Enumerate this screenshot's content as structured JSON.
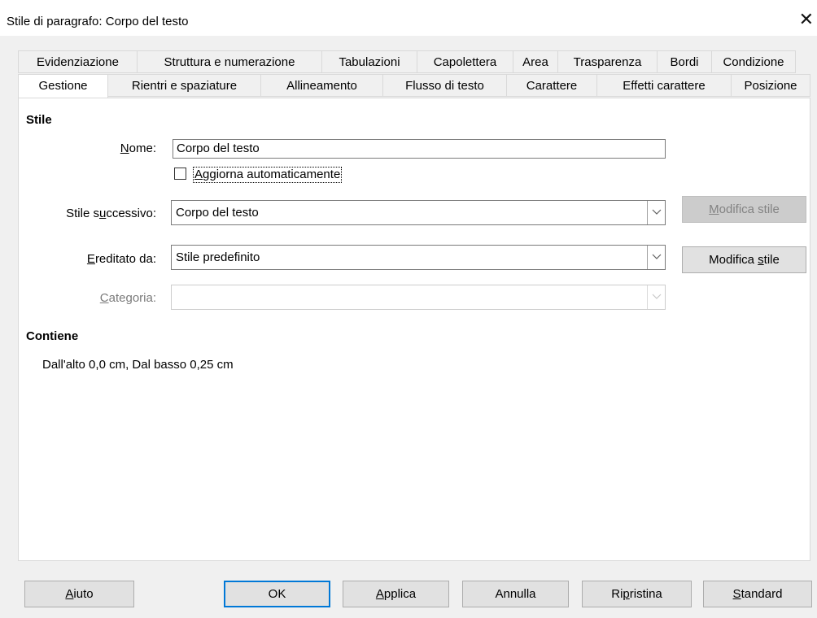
{
  "window": {
    "title": "Stile di paragrafo: Corpo del testo",
    "close_icon": "close-icon"
  },
  "tabs_row1": [
    {
      "label": "Evidenziazione"
    },
    {
      "label": "Struttura e numerazione"
    },
    {
      "label": "Tabulazioni"
    },
    {
      "label": "Capolettera"
    },
    {
      "label": "Area"
    },
    {
      "label": "Trasparenza"
    },
    {
      "label": "Bordi"
    },
    {
      "label": "Condizione"
    }
  ],
  "tabs_row2": [
    {
      "label": "Gestione",
      "active": true
    },
    {
      "label": "Rientri e spaziature"
    },
    {
      "label": "Allineamento"
    },
    {
      "label": "Flusso di testo"
    },
    {
      "label": "Carattere"
    },
    {
      "label": "Effetti carattere"
    },
    {
      "label": "Posizione"
    }
  ],
  "style_section": {
    "title": "Stile",
    "name_label_pre": "",
    "name_label_u": "N",
    "name_label_post": "ome:",
    "name_value": "Corpo del testo",
    "auto_update_u": "A",
    "auto_update_rest": "ggiorna automaticamente",
    "next_style_label_pre": "Stile s",
    "next_style_label_u": "u",
    "next_style_label_post": "ccessivo:",
    "next_style_value": "Corpo del testo",
    "edit_style_disabled_u": "M",
    "edit_style_disabled_rest": "odifica stile",
    "inherited_label_u": "E",
    "inherited_label_rest": "reditato da:",
    "inherited_value": "Stile predefinito",
    "edit_style_pre": "Modifica ",
    "edit_style_u": "s",
    "edit_style_post": "tile",
    "category_label_u": "C",
    "category_label_rest": "ategoria:",
    "category_value": ""
  },
  "contains_section": {
    "title": "Contiene",
    "text": "Dall'alto 0,0 cm, Dal basso 0,25 cm"
  },
  "buttons": {
    "help_u": "A",
    "help_rest": "iuto",
    "ok": "OK",
    "apply_u": "A",
    "apply_rest": "pplica",
    "cancel": "Annulla",
    "reset_pre": "Ri",
    "reset_u": "p",
    "reset_post": "ristina",
    "standard_u": "S",
    "standard_rest": "tandard"
  }
}
